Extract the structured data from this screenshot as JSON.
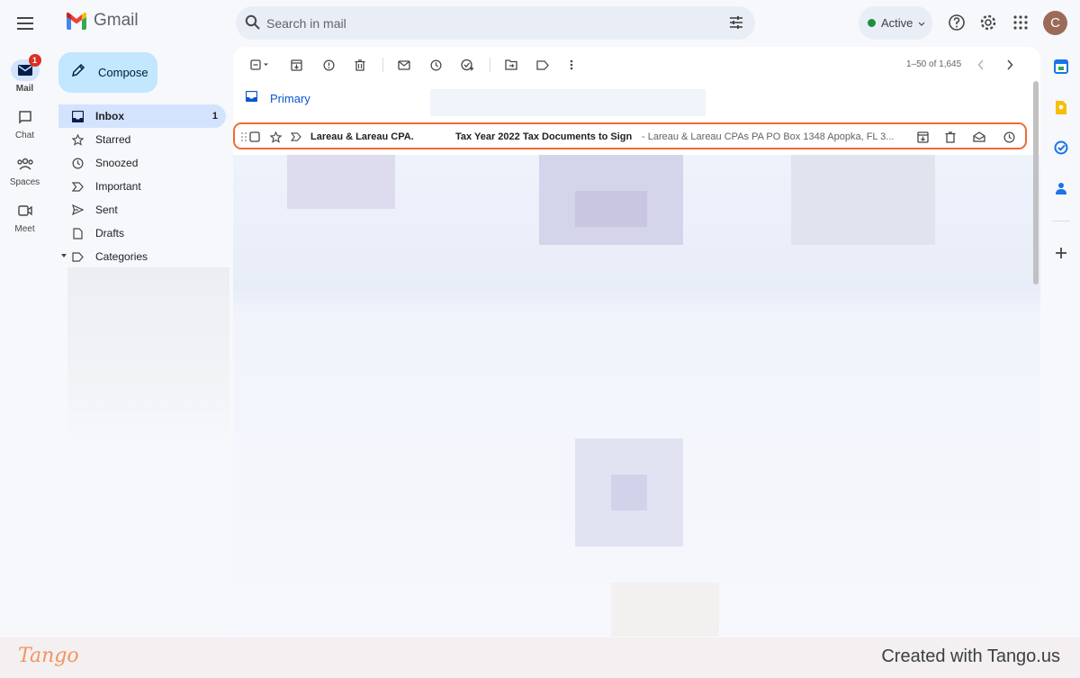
{
  "header": {
    "app_name": "Gmail",
    "search_placeholder": "Search in mail",
    "status_label": "Active",
    "avatar_initial": "C",
    "icons": [
      "menu-icon",
      "search-icon",
      "filter-icon",
      "help-icon",
      "settings-icon",
      "apps-icon"
    ]
  },
  "rail": {
    "items": [
      {
        "label": "Mail",
        "icon": "mail-icon",
        "badge": "1"
      },
      {
        "label": "Chat",
        "icon": "chat-icon"
      },
      {
        "label": "Spaces",
        "icon": "spaces-icon"
      },
      {
        "label": "Meet",
        "icon": "video-icon"
      }
    ]
  },
  "compose": {
    "label": "Compose"
  },
  "nav": {
    "items": [
      {
        "label": "Inbox",
        "icon": "inbox-icon",
        "count": "1"
      },
      {
        "label": "Starred",
        "icon": "star-icon"
      },
      {
        "label": "Snoozed",
        "icon": "clock-icon"
      },
      {
        "label": "Important",
        "icon": "important-icon"
      },
      {
        "label": "Sent",
        "icon": "send-icon"
      },
      {
        "label": "Drafts",
        "icon": "draft-icon"
      },
      {
        "label": "Categories",
        "icon": "label-icon"
      }
    ]
  },
  "toolbar": {
    "pager": "1–50 of 1,645"
  },
  "tabs": {
    "primary": "Primary"
  },
  "message": {
    "sender": "Lareau & Lareau CPA.",
    "subject": "Tax Year 2022 Tax Documents to Sign",
    "snippet": "- Lareau & Lareau CPAs PA PO Box 1348 Apopka, FL 3..."
  },
  "colors": {
    "accent": "#0b57d0",
    "highlight": "#f06a35",
    "compose_bg": "#c2e7ff",
    "active_nav": "#d3e3fd"
  },
  "footer": {
    "logo": "Tango",
    "credit": "Created with Tango.us"
  }
}
